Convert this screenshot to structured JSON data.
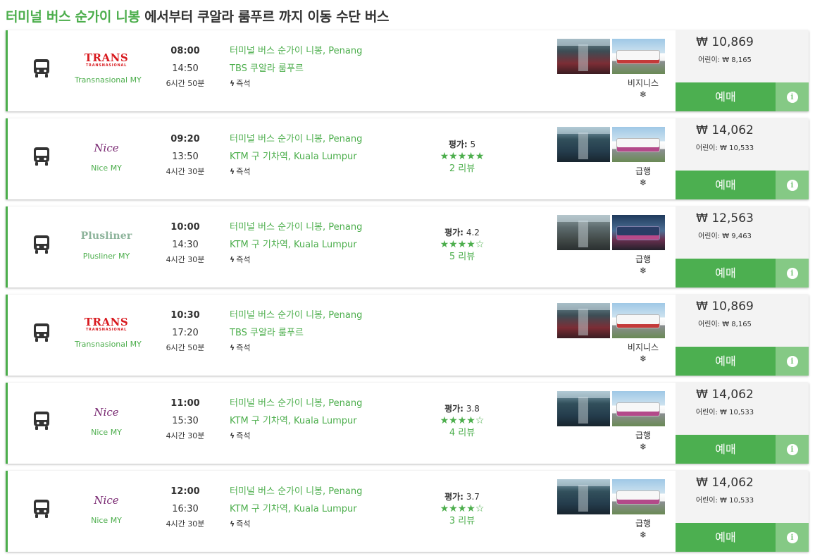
{
  "title": {
    "origin": "터미널 버스 순가이 니봉",
    "rest": "에서부터 쿠알라 룸푸르 까지 이동 수단 버스"
  },
  "colors": {
    "accent": "#4cae4c",
    "book_button": "#4caf50",
    "info_button": "#85c985"
  },
  "icons": {
    "bus": "bus-icon",
    "instant": "lightning-bolt-icon",
    "ac": "snowflake-icon",
    "info": "info-icon"
  },
  "trips": [
    {
      "logo_text": "TRANS",
      "logo_sub": "TRANSNASIONAL",
      "logo_style": "trans",
      "operator": "Transnasional MY",
      "departure": "08:00",
      "arrival": "14:50",
      "duration": "6시간 50분",
      "from": "터미널 버스 순가이 니봉, Penang",
      "to": "TBS 쿠알라 룸푸르",
      "instant": "즉석",
      "rating_label": "",
      "rating_value": "",
      "rating_stars": 0,
      "reviews": "",
      "bus_class": "비지니스",
      "ac": "❄",
      "price": "₩ 10,869",
      "child_price": "어린이: ₩ 8,165",
      "book_label": "예매",
      "info_label": "i"
    },
    {
      "logo_text": "Nice",
      "logo_sub": "",
      "logo_style": "nice",
      "operator": "Nice MY",
      "departure": "09:20",
      "arrival": "13:50",
      "duration": "4시간 30분",
      "from": "터미널 버스 순가이 니봉, Penang",
      "to": "KTM 구 기차역, Kuala Lumpur",
      "instant": "즉석",
      "rating_label": "평가:",
      "rating_value": "5",
      "rating_stars": 5,
      "reviews": "2 리뷰",
      "bus_class": "급행",
      "ac": "❄",
      "price": "₩ 14,062",
      "child_price": "어린이: ₩ 10,533",
      "book_label": "예매",
      "info_label": "i"
    },
    {
      "logo_text": "Plusliner",
      "logo_sub": "",
      "logo_style": "plus",
      "operator": "Plusliner MY",
      "departure": "10:00",
      "arrival": "14:30",
      "duration": "4시간 30분",
      "from": "터미널 버스 순가이 니봉, Penang",
      "to": "KTM 구 기차역, Kuala Lumpur",
      "instant": "즉석",
      "rating_label": "평가:",
      "rating_value": "4.2",
      "rating_stars": 4,
      "reviews": "5 리뷰",
      "bus_class": "급행",
      "ac": "❄",
      "price": "₩ 12,563",
      "child_price": "어린이: ₩ 9,463",
      "book_label": "예매",
      "info_label": "i"
    },
    {
      "logo_text": "TRANS",
      "logo_sub": "TRANSNASIONAL",
      "logo_style": "trans",
      "operator": "Transnasional MY",
      "departure": "10:30",
      "arrival": "17:20",
      "duration": "6시간 50분",
      "from": "터미널 버스 순가이 니봉, Penang",
      "to": "TBS 쿠알라 룸푸르",
      "instant": "즉석",
      "rating_label": "",
      "rating_value": "",
      "rating_stars": 0,
      "reviews": "",
      "bus_class": "비지니스",
      "ac": "❄",
      "price": "₩ 10,869",
      "child_price": "어린이: ₩ 8,165",
      "book_label": "예매",
      "info_label": "i"
    },
    {
      "logo_text": "Nice",
      "logo_sub": "",
      "logo_style": "nice",
      "operator": "Nice MY",
      "departure": "11:00",
      "arrival": "15:30",
      "duration": "4시간 30분",
      "from": "터미널 버스 순가이 니봉, Penang",
      "to": "KTM 구 기차역, Kuala Lumpur",
      "instant": "즉석",
      "rating_label": "평가:",
      "rating_value": "3.8",
      "rating_stars": 4,
      "reviews": "4 리뷰",
      "bus_class": "급행",
      "ac": "❄",
      "price": "₩ 14,062",
      "child_price": "어린이: ₩ 10,533",
      "book_label": "예매",
      "info_label": "i"
    },
    {
      "logo_text": "Nice",
      "logo_sub": "",
      "logo_style": "nice",
      "operator": "Nice MY",
      "departure": "12:00",
      "arrival": "16:30",
      "duration": "4시간 30분",
      "from": "터미널 버스 순가이 니봉, Penang",
      "to": "KTM 구 기차역, Kuala Lumpur",
      "instant": "즉석",
      "rating_label": "평가:",
      "rating_value": "3.7",
      "rating_stars": 4,
      "reviews": "3 리뷰",
      "bus_class": "급행",
      "ac": "❄",
      "price": "₩ 14,062",
      "child_price": "어린이: ₩ 10,533",
      "book_label": "예매",
      "info_label": "i"
    }
  ]
}
